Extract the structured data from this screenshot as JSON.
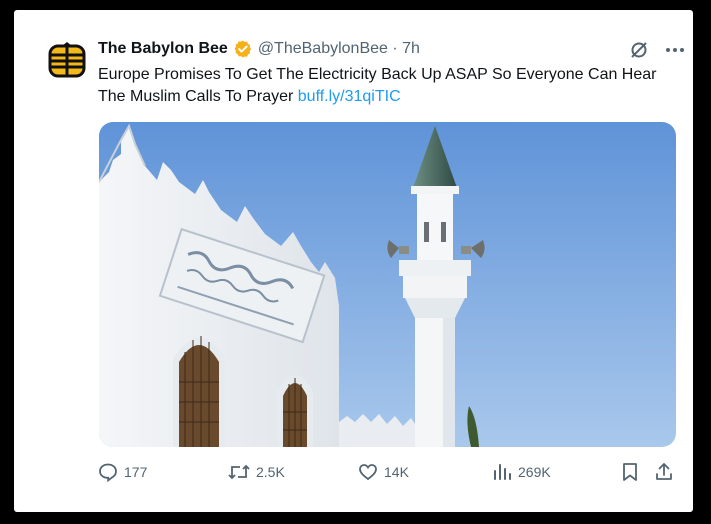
{
  "tweet": {
    "author_name": "The Babylon Bee",
    "handle_time": "@TheBabylonBee · 7h",
    "text": "Europe Promises To Get The Electricity Back Up ASAP So Everyone Can Hear The Muslim Calls To Prayer",
    "link": "buff.ly/31qiTIC",
    "media_icons": [
      "building-with-arches",
      "minaret-with-loudspeakers"
    ]
  },
  "actions": {
    "replies": "177",
    "reposts": "2.5K",
    "likes": "14K",
    "views": "269K"
  },
  "colors": {
    "accent": "#1d9bf0",
    "verified": "#f5b11b",
    "text": "#0f1419",
    "muted": "#536471"
  },
  "icons": [
    "bee-logo-icon",
    "verified-badge-icon",
    "grok-icon",
    "more-icon",
    "reply-icon",
    "repost-icon",
    "like-icon",
    "views-icon",
    "bookmark-icon",
    "share-icon"
  ]
}
